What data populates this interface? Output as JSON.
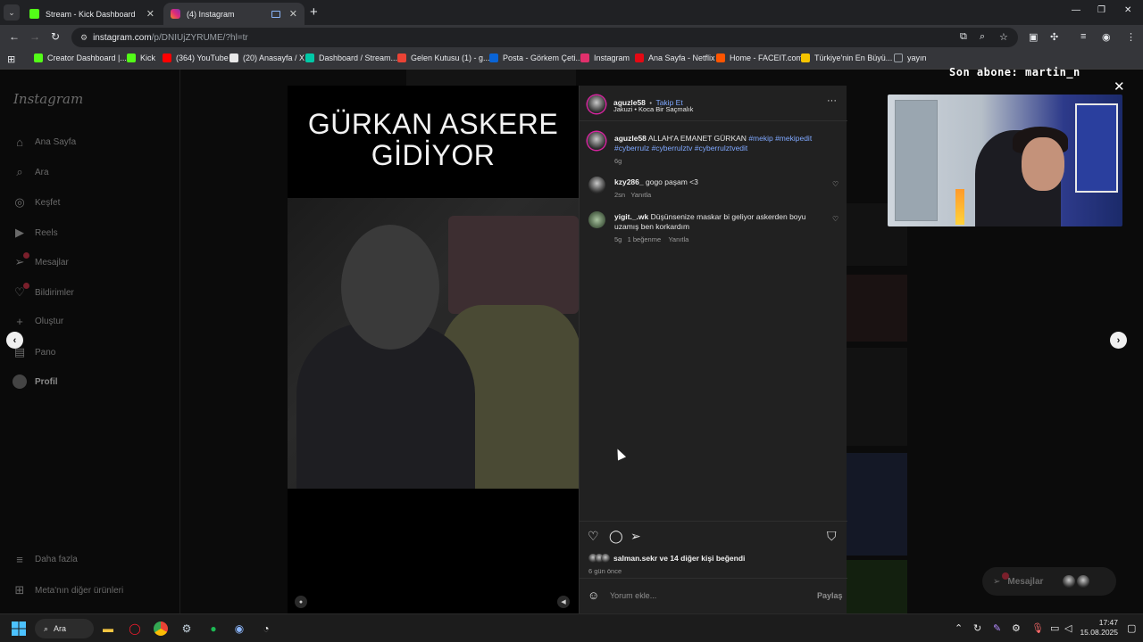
{
  "browser": {
    "tabs": [
      {
        "label": "Stream - Kick Dashboard",
        "favicon_color": "#53fc18"
      },
      {
        "label": "(4) Instagram",
        "favicon_color": "#e1306c"
      }
    ],
    "url_host": "instagram.com",
    "url_path": "/p/DNIUjZYRUME/?hl=tr",
    "bookmarks": [
      {
        "label": "Creator Dashboard |...",
        "color": "#53fc18"
      },
      {
        "label": "Kick",
        "color": "#53fc18"
      },
      {
        "label": "(364) YouTube",
        "color": "#ff0000"
      },
      {
        "label": "(20) Anasayfa / X",
        "color": "#e8e8e8"
      },
      {
        "label": "Dashboard / Stream...",
        "color": "#00c9a7"
      },
      {
        "label": "Gelen Kutusu (1) - g...",
        "color": "#ea4335"
      },
      {
        "label": "Posta - Görkem Çeti...",
        "color": "#0a64d6"
      },
      {
        "label": "Instagram",
        "color": "#e1306c"
      },
      {
        "label": "Ana Sayfa - Netflix",
        "color": "#e50914"
      },
      {
        "label": "Home - FACEIT.com",
        "color": "#ff5500"
      },
      {
        "label": "Türkiye'nin En Büyü...",
        "color": "#f5c400"
      },
      {
        "label": "yayın",
        "color": "#9aa0a6"
      }
    ]
  },
  "sidebar": {
    "logo": "Instagram",
    "items": [
      {
        "label": "Ana Sayfa",
        "icon": "home-icon"
      },
      {
        "label": "Ara",
        "icon": "search-icon"
      },
      {
        "label": "Keşfet",
        "icon": "compass-icon"
      },
      {
        "label": "Reels",
        "icon": "reels-icon"
      },
      {
        "label": "Mesajlar",
        "icon": "messenger-icon"
      },
      {
        "label": "Bildirimler",
        "icon": "heart-icon"
      },
      {
        "label": "Oluştur",
        "icon": "plus-icon"
      },
      {
        "label": "Pano",
        "icon": "dashboard-icon"
      },
      {
        "label": "Profil",
        "icon": "avatar"
      }
    ],
    "more": "Daha fazla",
    "meta": "Meta'nın diğer ürünleri"
  },
  "video": {
    "title_line1": "GÜRKAN ASKERE",
    "title_line2": "GİDİYOR"
  },
  "post": {
    "author": "aguzle58",
    "follow": "Takip Et",
    "audio": "Jakuzi • Koca Bir Saçmalık",
    "caption_user": "aguzle58",
    "caption_text": "ALLAH'A EMANET GÜRKAN",
    "caption_tags_1": "#mekip #mekipedit",
    "caption_tags_2": "#cyberrulz #cyberrulztv #cyberrulztvedit",
    "caption_time": "6g",
    "comments": [
      {
        "user": "kzy286_",
        "text": "gogo paşam <3",
        "time": "2sn",
        "reply": "Yanıtla",
        "likes": ""
      },
      {
        "user": "yigit._.wk",
        "text": "Düşünsenize maskar bi geliyor askerden boyu uzamış ben korkardım",
        "time": "5g",
        "likes": "1 beğenme",
        "reply": "Yanıtla"
      }
    ],
    "likes_text": "salman.sekr ve 14 diğer kişi beğendi",
    "date": "6 gün önce",
    "comment_placeholder": "Yorum ekle...",
    "share": "Paylaş"
  },
  "overlay": {
    "last_sub": "Son abone: martin_n"
  },
  "messages_pill": "Mesajlar",
  "taskbar": {
    "search": "Ara",
    "time": "17:47",
    "date": "15.08.2025"
  }
}
